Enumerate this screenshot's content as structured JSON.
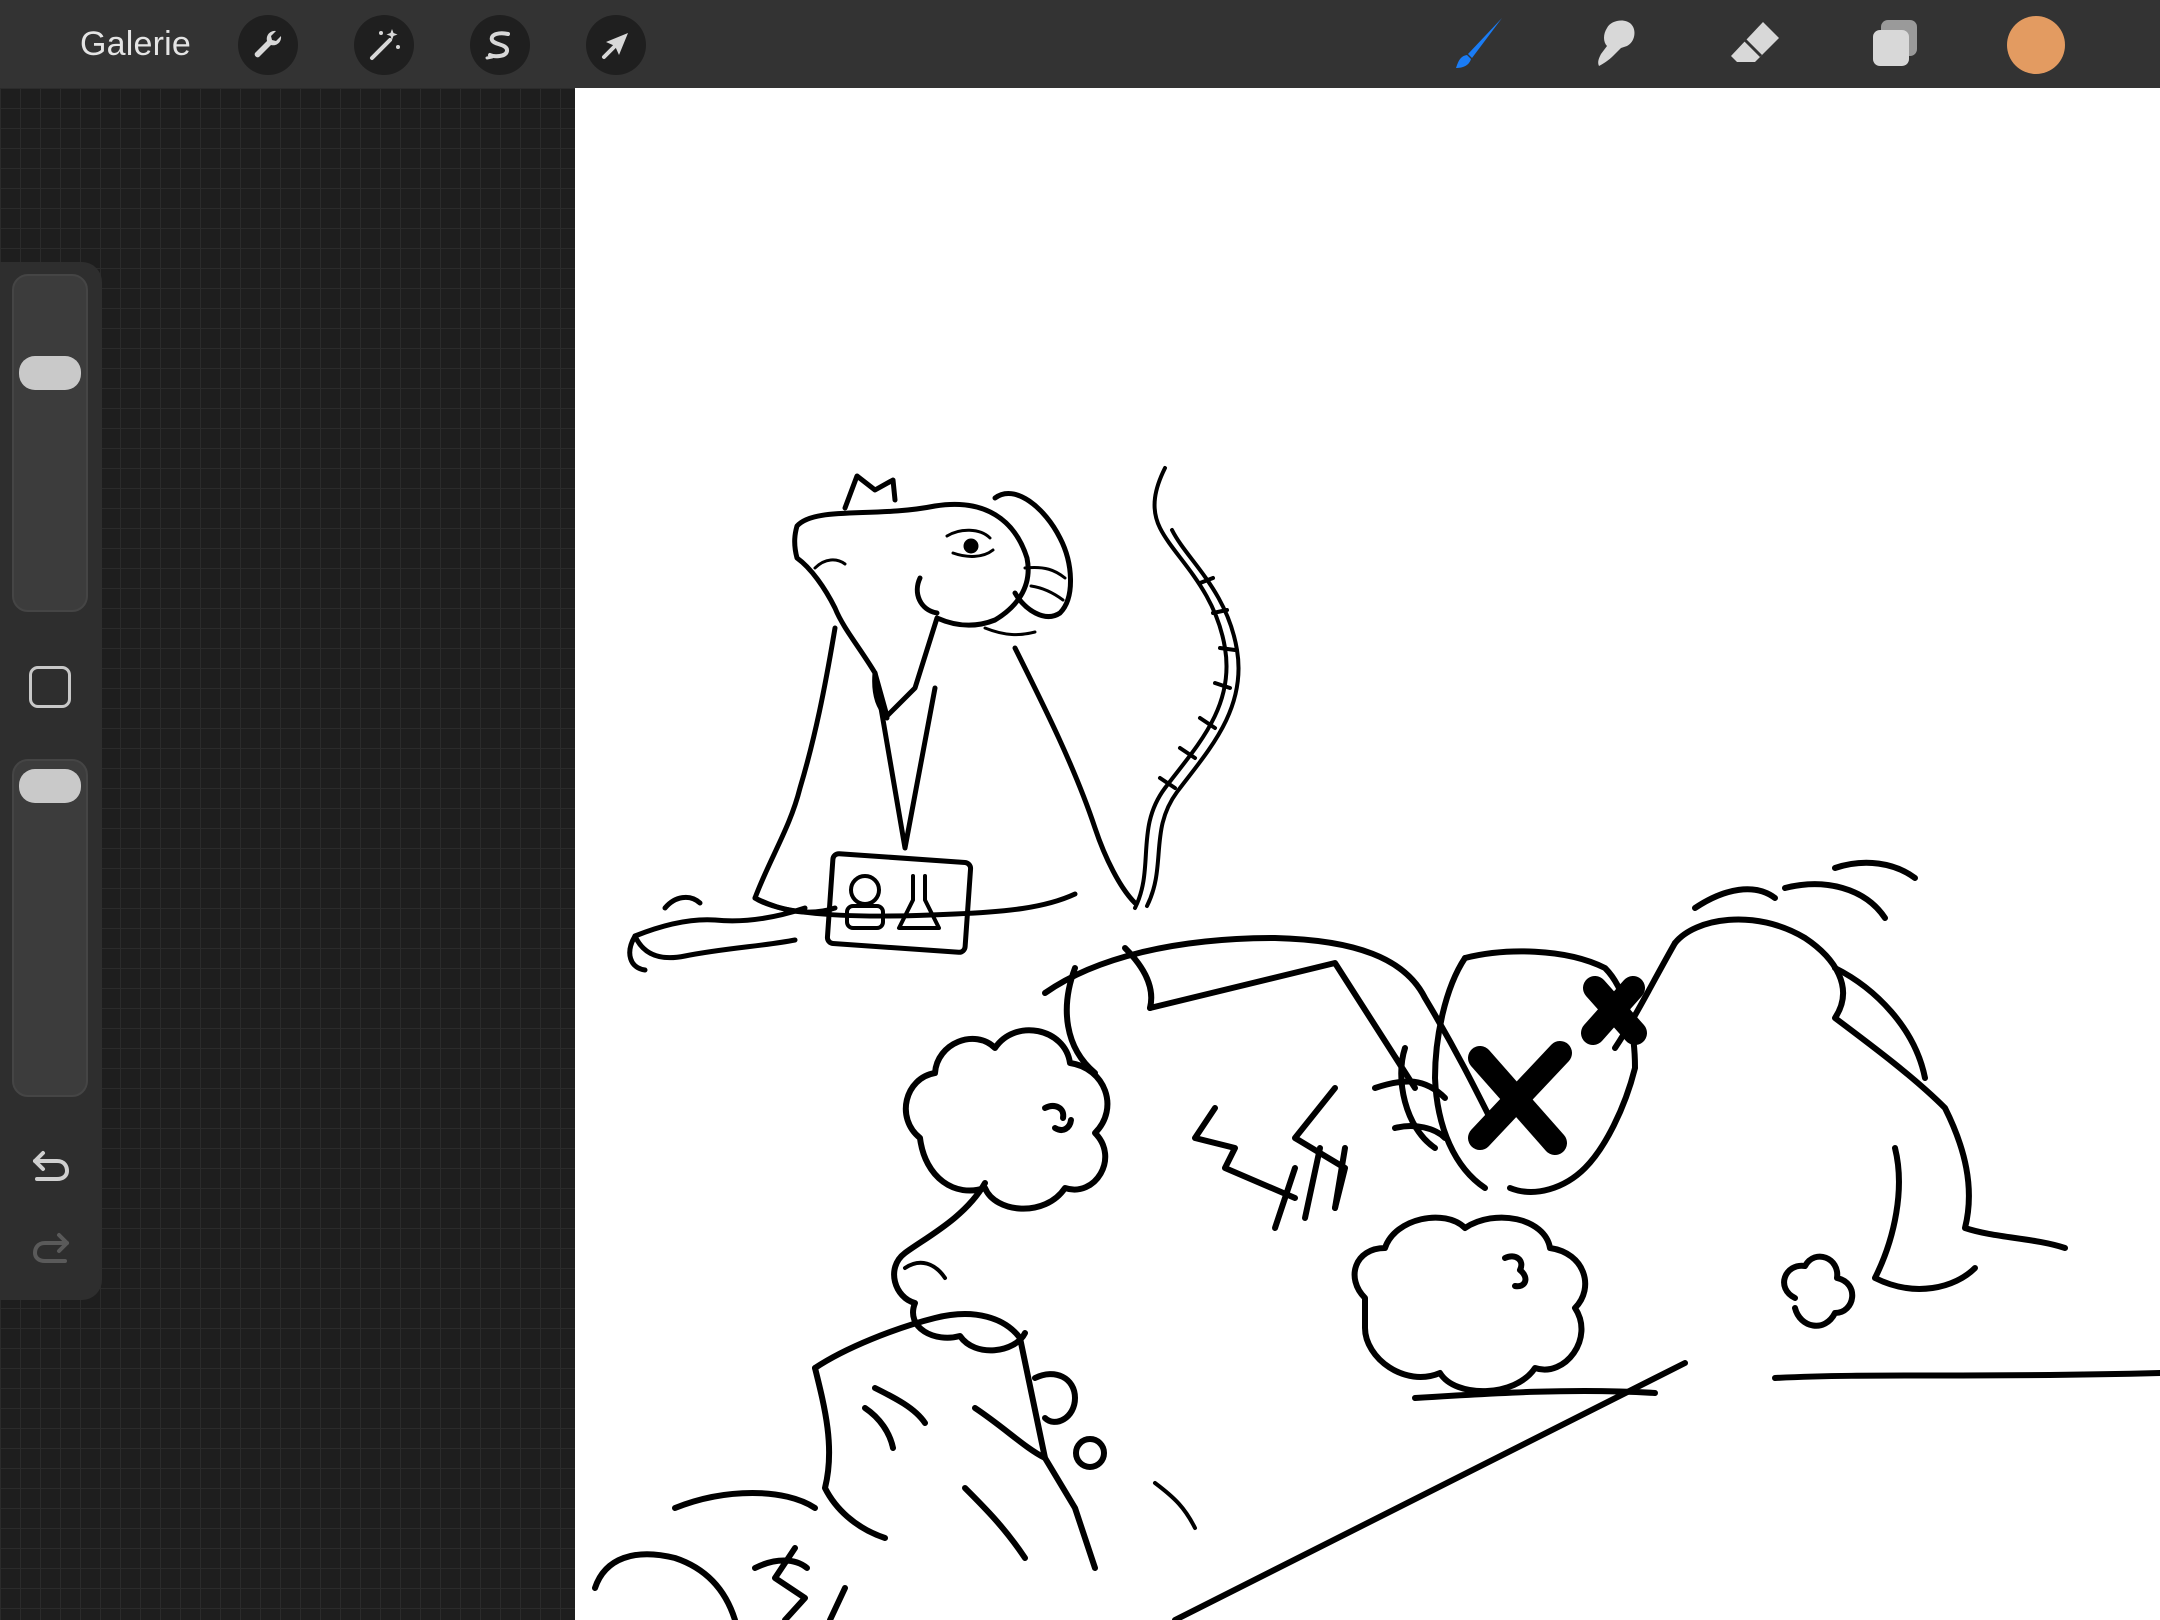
{
  "topbar": {
    "gallery_label": "Galerie",
    "left_tools": [
      "wrench-icon",
      "magic-wand-icon",
      "selection-s-icon",
      "transform-arrow-icon"
    ],
    "right_tools": [
      "brush-icon",
      "smudge-icon",
      "eraser-icon",
      "layers-icon"
    ],
    "active_tool": "brush-icon",
    "current_color": "#e39b61"
  },
  "sidebar": {
    "size_slider_value": 0.2,
    "opacity_slider_value": 0.0,
    "icons": [
      "modify-square-icon",
      "undo-icon",
      "redo-icon"
    ]
  },
  "colors": {
    "accent": "#1a7cf5",
    "topbar_bg": "#333333",
    "icon_fg": "#d8d8d8"
  }
}
